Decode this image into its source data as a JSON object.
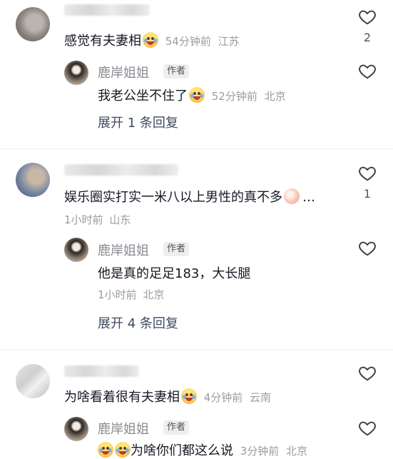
{
  "comments": [
    {
      "name_blurred": "一虹 and 未言",
      "text": "感觉有夫妻相",
      "time": "54分钟前",
      "location": "江苏",
      "likes": "2",
      "reply": {
        "name": "鹿岸姐姐",
        "tag": "作者",
        "text": "我老公坐不住了",
        "time": "52分钟前",
        "location": "北京"
      },
      "expand": "展开 1 条回复"
    },
    {
      "name_blurred": "一 7RAOD",
      "text": "娱乐圈实打实一米八以上男性的真不多",
      "ellipsis": "…",
      "time": "1小时前",
      "location": "山东",
      "likes": "1",
      "reply": {
        "name": "鹿岸姐姐",
        "tag": "作者",
        "text": "他是真的足足183，大长腿",
        "time": "1小时前",
        "location": "北京"
      },
      "expand": "展开 4 条回复"
    },
    {
      "name_blurred": "",
      "text": "为啥看着很有夫妻相",
      "time": "4分钟前",
      "location": "云南",
      "reply": {
        "name": "鹿岸姐姐",
        "tag": "作者",
        "text": "为啥你们都这么说",
        "time": "3分钟前",
        "location": "北京"
      }
    }
  ],
  "icons": {
    "like": "heart-outline-icon",
    "emoji_cry_laugh": "crying-laughing-emoji-icon",
    "emoji_peach": "peach-emoji-icon"
  },
  "colors": {
    "text": "#161823",
    "meta": "#9a9ba1",
    "name": "#8a8b91",
    "expand": "#3f4a5f"
  }
}
